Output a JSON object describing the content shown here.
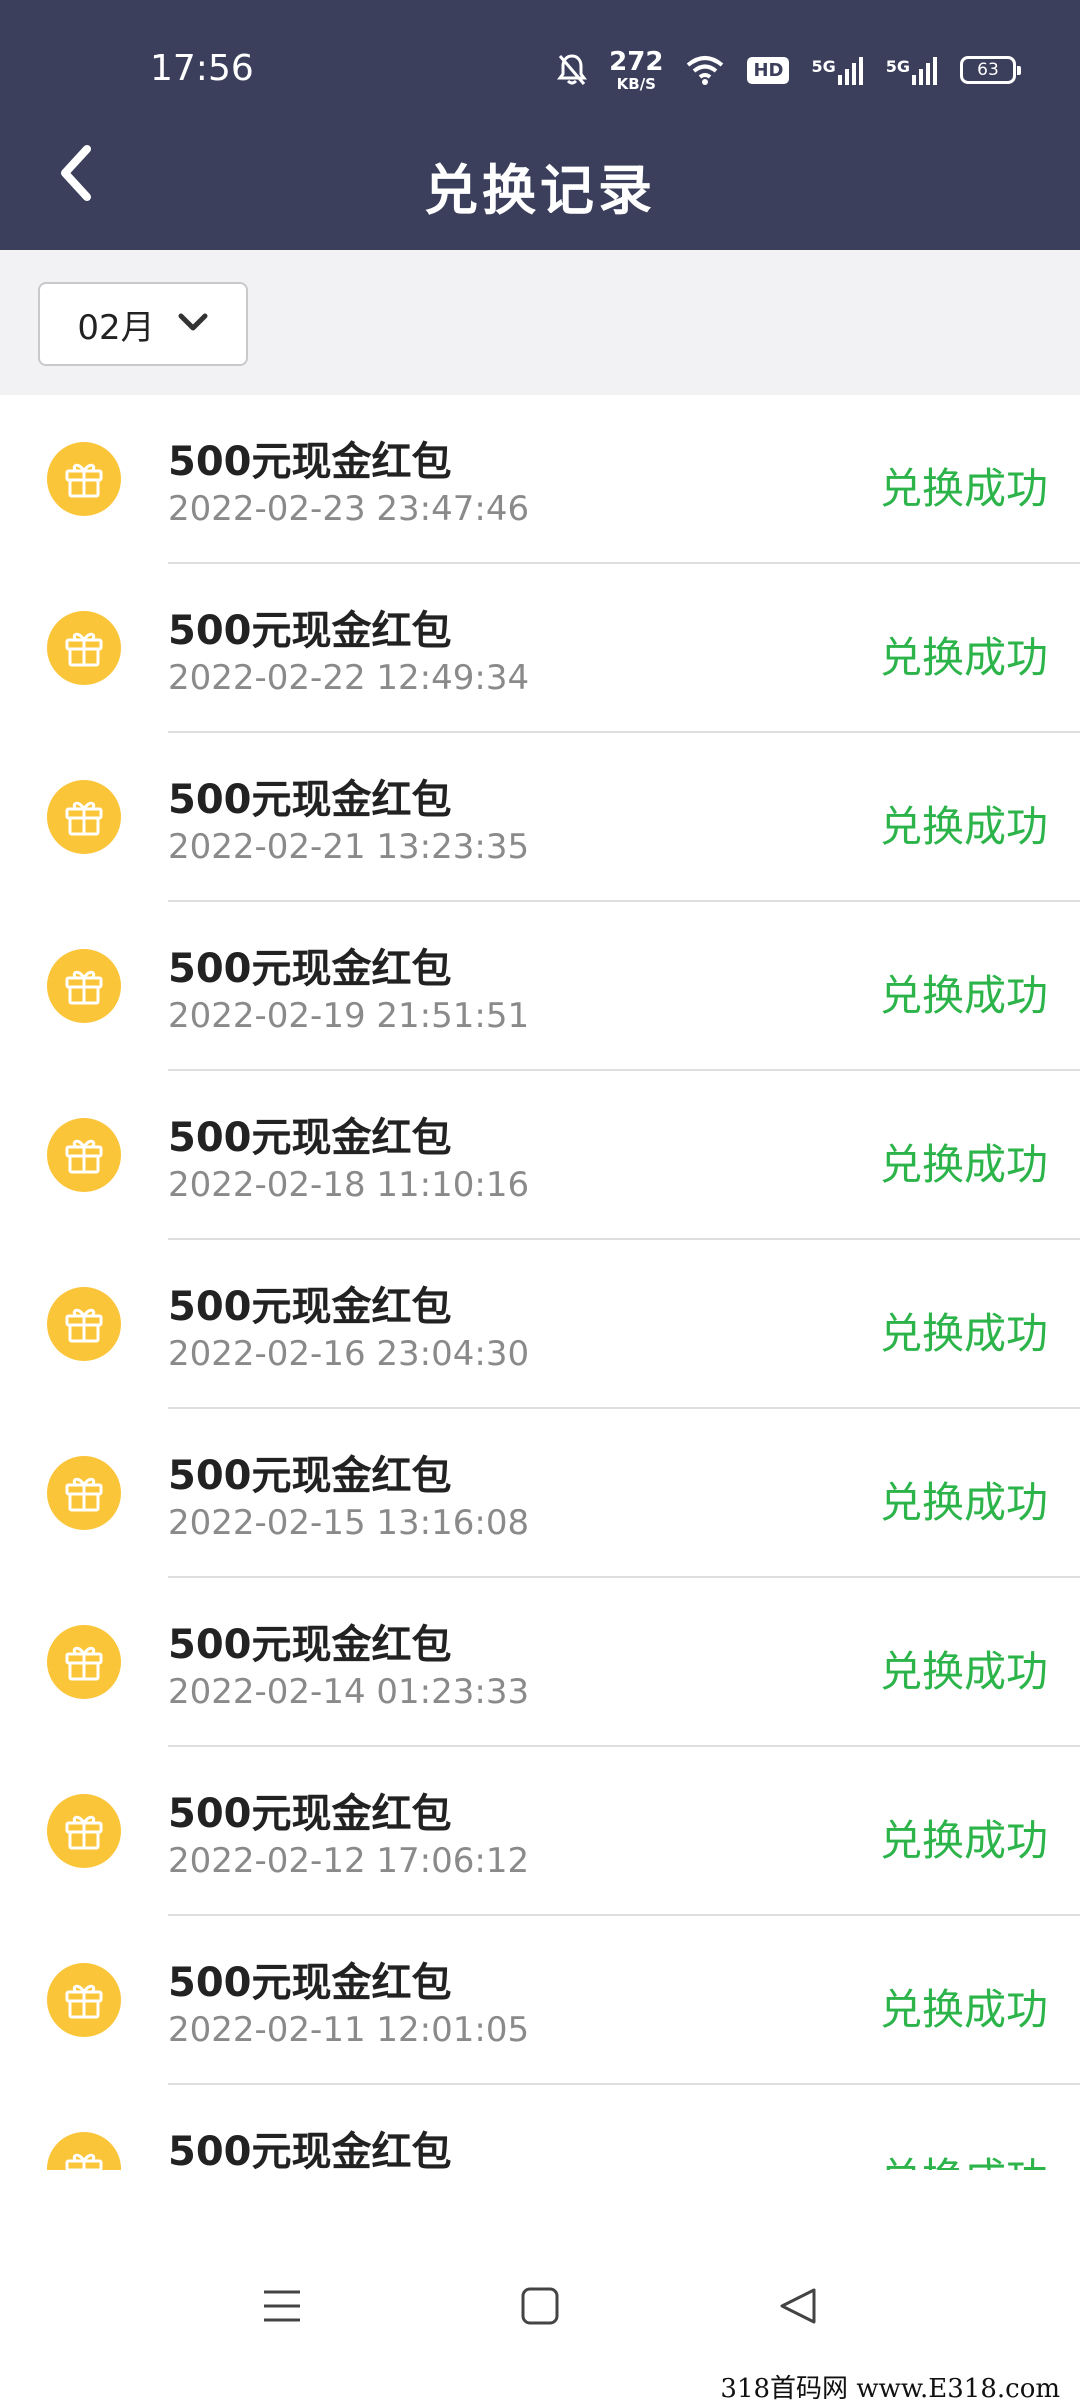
{
  "status_bar": {
    "time": "17:56",
    "net_speed_value": "272",
    "net_speed_unit": "KB/S",
    "hd_label": "HD",
    "network_1": "5G",
    "network_2": "5G",
    "battery": "63",
    "icons": [
      "bell-off-icon",
      "wifi-icon",
      "signal-icon",
      "signal-icon",
      "battery-icon"
    ]
  },
  "header": {
    "title": "兑换记录",
    "back_icon": "chevron-left-icon"
  },
  "filter": {
    "month": "02月",
    "dropdown_icon": "chevron-down-icon"
  },
  "colors": {
    "header_bg": "#3b3f5c",
    "status_success": "#2cb44a",
    "gift_icon_bg": "#fbc53a"
  },
  "records": [
    {
      "title": "500元现金红包",
      "time": "2022-02-23 23:47:46",
      "status": "兑换成功"
    },
    {
      "title": "500元现金红包",
      "time": "2022-02-22 12:49:34",
      "status": "兑换成功"
    },
    {
      "title": "500元现金红包",
      "time": "2022-02-21 13:23:35",
      "status": "兑换成功"
    },
    {
      "title": "500元现金红包",
      "time": "2022-02-19 21:51:51",
      "status": "兑换成功"
    },
    {
      "title": "500元现金红包",
      "time": "2022-02-18 11:10:16",
      "status": "兑换成功"
    },
    {
      "title": "500元现金红包",
      "time": "2022-02-16 23:04:30",
      "status": "兑换成功"
    },
    {
      "title": "500元现金红包",
      "time": "2022-02-15 13:16:08",
      "status": "兑换成功"
    },
    {
      "title": "500元现金红包",
      "time": "2022-02-14 01:23:33",
      "status": "兑换成功"
    },
    {
      "title": "500元现金红包",
      "time": "2022-02-12 17:06:12",
      "status": "兑换成功"
    },
    {
      "title": "500元现金红包",
      "time": "2022-02-11 12:01:05",
      "status": "兑换成功"
    },
    {
      "title": "500元现金红包",
      "time": "",
      "status": "兑换成功"
    }
  ],
  "nav_bar": {
    "icons": [
      "menu-icon",
      "home-icon",
      "back-icon"
    ]
  },
  "watermark": "318首码网 www.E318.com"
}
